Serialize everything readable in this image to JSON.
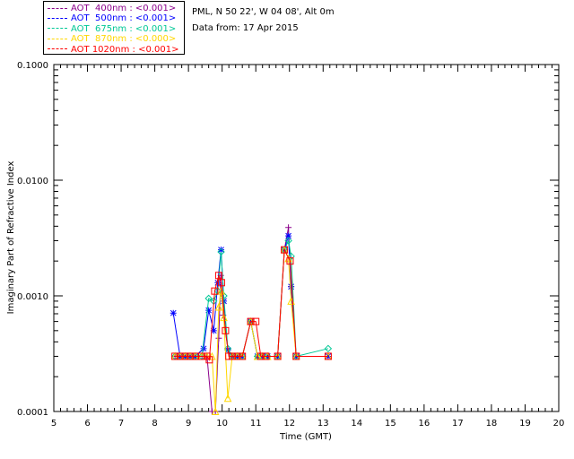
{
  "legend": [
    {
      "label": "AOT  400nm : <0.001>",
      "color": "#8b008b"
    },
    {
      "label": "AOT  500nm : <0.001>",
      "color": "#0000ff"
    },
    {
      "label": "AOT  675nm : <0.001>",
      "color": "#00c896"
    },
    {
      "label": "AOT  870nm : <0.000>",
      "color": "#ffd700"
    },
    {
      "label": "AOT 1020nm : <0.001>",
      "color": "#ff0000"
    }
  ],
  "info": {
    "site": "PML, N 50 22', W 04 08', Alt 0m",
    "date": "Data from: 17 Apr 2015"
  },
  "chart_data": {
    "type": "line",
    "ylabel": "Imaginary Part of Refractive Index",
    "xlabel": "Time (GMT)",
    "xlim": [
      5,
      20
    ],
    "ylim": [
      0.0001,
      0.1
    ],
    "yscale": "log",
    "xticks": [
      "5",
      "6",
      "7",
      "8",
      "9",
      "10",
      "11",
      "12",
      "13",
      "14",
      "15",
      "16",
      "17",
      "18",
      "19",
      "20"
    ],
    "yticks": [
      {
        "v": 0.0001,
        "label": "0.0001"
      },
      {
        "v": 0.001,
        "label": "0.0010"
      },
      {
        "v": 0.01,
        "label": "0.0100"
      },
      {
        "v": 0.1,
        "label": "0.1000"
      }
    ],
    "series": [
      {
        "name": "AOT 400nm",
        "color": "#8b008b",
        "marker": "plus",
        "points": [
          [
            8.6,
            0.0003
          ],
          [
            8.75,
            0.0003
          ],
          [
            8.9,
            0.0003
          ],
          [
            9.05,
            0.0003
          ],
          [
            9.2,
            0.0003
          ],
          [
            9.4,
            0.0003
          ],
          [
            9.55,
            0.0003
          ],
          [
            9.7,
            0.0001
          ],
          [
            9.8,
            0.0001
          ],
          [
            9.9,
            0.00043
          ],
          [
            9.96,
            0.0015
          ],
          [
            10.03,
            0.00068
          ],
          [
            10.17,
            0.00035
          ],
          [
            10.3,
            0.0003
          ],
          [
            10.45,
            0.0003
          ],
          [
            10.6,
            0.0003
          ],
          [
            10.85,
            0.0006
          ],
          [
            11.05,
            0.0003
          ],
          [
            11.2,
            0.0003
          ],
          [
            11.35,
            0.0003
          ],
          [
            11.65,
            0.0003
          ],
          [
            11.85,
            0.0025
          ],
          [
            11.97,
            0.0039
          ],
          [
            12.05,
            0.0012
          ],
          [
            12.2,
            0.0003
          ],
          [
            13.15,
            0.0003
          ]
        ]
      },
      {
        "name": "AOT 500nm",
        "color": "#0000ff",
        "marker": "star",
        "points": [
          [
            8.55,
            0.00071
          ],
          [
            8.75,
            0.0003
          ],
          [
            8.9,
            0.0003
          ],
          [
            9.05,
            0.0003
          ],
          [
            9.2,
            0.0003
          ],
          [
            9.45,
            0.00035
          ],
          [
            9.6,
            0.00075
          ],
          [
            9.75,
            0.0005
          ],
          [
            9.87,
            0.0013
          ],
          [
            9.97,
            0.0025
          ],
          [
            10.05,
            0.0009
          ],
          [
            10.17,
            0.00034
          ],
          [
            10.3,
            0.0003
          ],
          [
            10.45,
            0.0003
          ],
          [
            10.6,
            0.0003
          ],
          [
            10.85,
            0.0006
          ],
          [
            11.05,
            0.0003
          ],
          [
            11.2,
            0.0003
          ],
          [
            11.35,
            0.0003
          ],
          [
            11.65,
            0.0003
          ],
          [
            11.85,
            0.0025
          ],
          [
            11.97,
            0.0033
          ],
          [
            12.05,
            0.0012
          ],
          [
            12.2,
            0.0003
          ],
          [
            13.15,
            0.0003
          ]
        ]
      },
      {
        "name": "AOT 675nm",
        "color": "#00c896",
        "marker": "diamond",
        "points": [
          [
            8.6,
            0.0003
          ],
          [
            8.75,
            0.0003
          ],
          [
            8.9,
            0.0003
          ],
          [
            9.05,
            0.0003
          ],
          [
            9.2,
            0.0003
          ],
          [
            9.4,
            0.0003
          ],
          [
            9.6,
            0.00095
          ],
          [
            9.75,
            0.0009
          ],
          [
            9.87,
            0.0011
          ],
          [
            9.97,
            0.0024
          ],
          [
            10.05,
            0.001
          ],
          [
            10.17,
            0.00035
          ],
          [
            10.3,
            0.0003
          ],
          [
            10.45,
            0.0003
          ],
          [
            10.6,
            0.0003
          ],
          [
            10.85,
            0.0006
          ],
          [
            11.05,
            0.0003
          ],
          [
            11.2,
            0.0003
          ],
          [
            11.35,
            0.0003
          ],
          [
            11.65,
            0.0003
          ],
          [
            11.85,
            0.0025
          ],
          [
            11.97,
            0.003
          ],
          [
            12.05,
            0.0022
          ],
          [
            12.2,
            0.0003
          ],
          [
            13.15,
            0.00035
          ]
        ]
      },
      {
        "name": "AOT 870nm",
        "color": "#ffd700",
        "marker": "triangle",
        "points": [
          [
            8.6,
            0.0003
          ],
          [
            8.75,
            0.0003
          ],
          [
            8.9,
            0.0003
          ],
          [
            9.05,
            0.0003
          ],
          [
            9.2,
            0.0003
          ],
          [
            9.4,
            0.0003
          ],
          [
            9.55,
            0.0003
          ],
          [
            9.7,
            0.0003
          ],
          [
            9.8,
            0.0001
          ],
          [
            9.9,
            0.0008
          ],
          [
            9.97,
            0.0011
          ],
          [
            10.05,
            0.00065
          ],
          [
            10.17,
            0.00013
          ],
          [
            10.3,
            0.0003
          ],
          [
            10.45,
            0.0003
          ],
          [
            10.6,
            0.0003
          ],
          [
            10.85,
            0.0006
          ],
          [
            11.05,
            0.0003
          ],
          [
            11.2,
            0.0003
          ],
          [
            11.35,
            0.0003
          ],
          [
            11.65,
            0.0003
          ],
          [
            11.85,
            0.0025
          ],
          [
            11.97,
            0.0021
          ],
          [
            12.05,
            0.0009
          ],
          [
            12.2,
            0.0003
          ],
          [
            13.15,
            0.0003
          ]
        ]
      },
      {
        "name": "AOT 1020nm",
        "color": "#ff0000",
        "marker": "square",
        "points": [
          [
            8.6,
            0.0003
          ],
          [
            8.75,
            0.0003
          ],
          [
            8.9,
            0.0003
          ],
          [
            9.05,
            0.0003
          ],
          [
            9.2,
            0.0003
          ],
          [
            9.4,
            0.0003
          ],
          [
            9.55,
            0.0003
          ],
          [
            9.62,
            0.00028
          ],
          [
            9.78,
            0.0011
          ],
          [
            9.9,
            0.0015
          ],
          [
            9.98,
            0.0013
          ],
          [
            10.1,
            0.0005
          ],
          [
            10.2,
            0.0003
          ],
          [
            10.3,
            0.0003
          ],
          [
            10.45,
            0.0003
          ],
          [
            10.6,
            0.0003
          ],
          [
            10.85,
            0.0006
          ],
          [
            11.0,
            0.0006
          ],
          [
            11.15,
            0.0003
          ],
          [
            11.3,
            0.0003
          ],
          [
            11.65,
            0.0003
          ],
          [
            11.85,
            0.0025
          ],
          [
            12.02,
            0.002
          ],
          [
            12.2,
            0.0003
          ],
          [
            13.15,
            0.0003
          ]
        ]
      }
    ]
  }
}
